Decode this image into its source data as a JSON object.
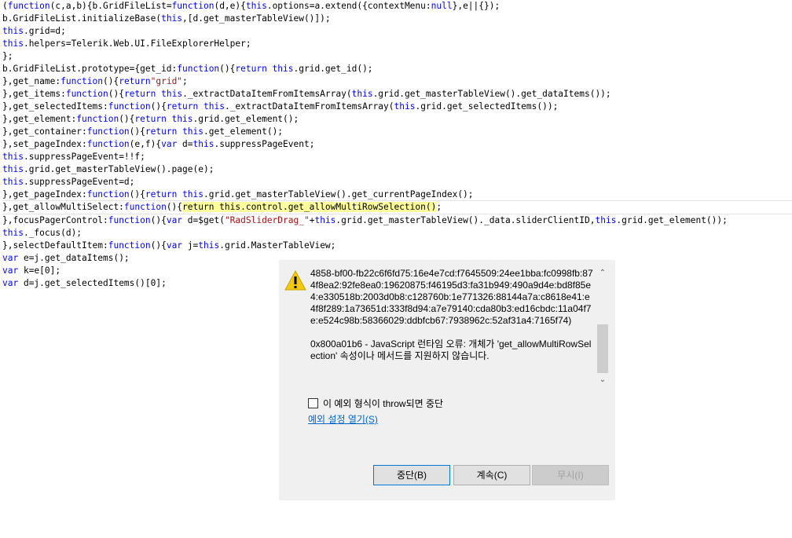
{
  "code_lines": [
    "(function(c,a,b){b.GridFileList=function(d,e){this.options=a.extend({contextMenu:null},e||{});",
    "b.GridFileList.initializeBase(this,[d.get_masterTableView()]);",
    "this.grid=d;",
    "this.helpers=Telerik.Web.UI.FileExplorerHelper;",
    "};",
    "b.GridFileList.prototype={get_id:function(){return this.grid.get_id();",
    "},get_name:function(){return\"grid\";",
    "},get_items:function(){return this._extractDataItemFromItemsArray(this.grid.get_masterTableView().get_dataItems());",
    "},get_selectedItems:function(){return this._extractDataItemFromItemsArray(this.grid.get_selectedItems());",
    "},get_element:function(){return this.grid.get_element();",
    "},get_container:function(){return this.get_element();",
    "},set_pageIndex:function(e,f){var d=this.suppressPageEvent;",
    "this.suppressPageEvent=!!f;",
    "this.grid.get_masterTableView().page(e);",
    "this.suppressPageEvent=d;",
    "},get_pageIndex:function(){return this.grid.get_masterTableView().get_currentPageIndex();",
    "},get_allowMultiSelect:function(){return this.control.get_allowMultiRowSelection();",
    "},focusPagerControl:function(){var d=$get(\"RadSliderDrag_\"+this.grid.get_masterTableView()._data.sliderClientID,this.grid.get_element());",
    "this._focus(d);",
    "},selectDefaultItem:function(){var j=this.grid.MasterTableView;",
    "var e=j.get_dataItems();",
    "var k=e[0];",
    "var d=j.get_selectedItems()[0];"
  ],
  "highlighted_line_index": 16,
  "highlighted_text": "return this.control.get_allowMultiRowSelection()",
  "dialog": {
    "error_code": "4858-bf00-fb22c6f6fd75:16e4e7cd:f7645509:24ee1bba:fc0998fb:874f8ea2:92fe8ea0:19620875:f46195d3:fa31b949:490a9d4e:bd8f85e4:e330518b:2003d0b8:c128760b:1e771326:88144a7a:c8618e41:e4f8f289:1a73651d:333f8d94:a7e79140:cda80b3:ed16cbdc:11a04f7e:e524c98b:58366029:ddbfcb67:7938962c:52af31a4:7165f74)",
    "error_message": "0x800a01b6 - JavaScript 런타임 오류: 개체가 'get_allowMultiRowSelection' 속성이나 메서드를 지원하지 않습니다.",
    "checkbox_label": "이 예외 형식이 throw되면 중단",
    "settings_link": "예외 설정 열기(S)",
    "buttons": {
      "break": "중단(B)",
      "continue": "계속(C)",
      "ignore": "무시(I)"
    },
    "icon": "warning-icon",
    "colors": {
      "warning": "#f2c811",
      "link": "#0066cc",
      "primary_border": "#0078d7",
      "highlight": "#ffff9e"
    }
  }
}
